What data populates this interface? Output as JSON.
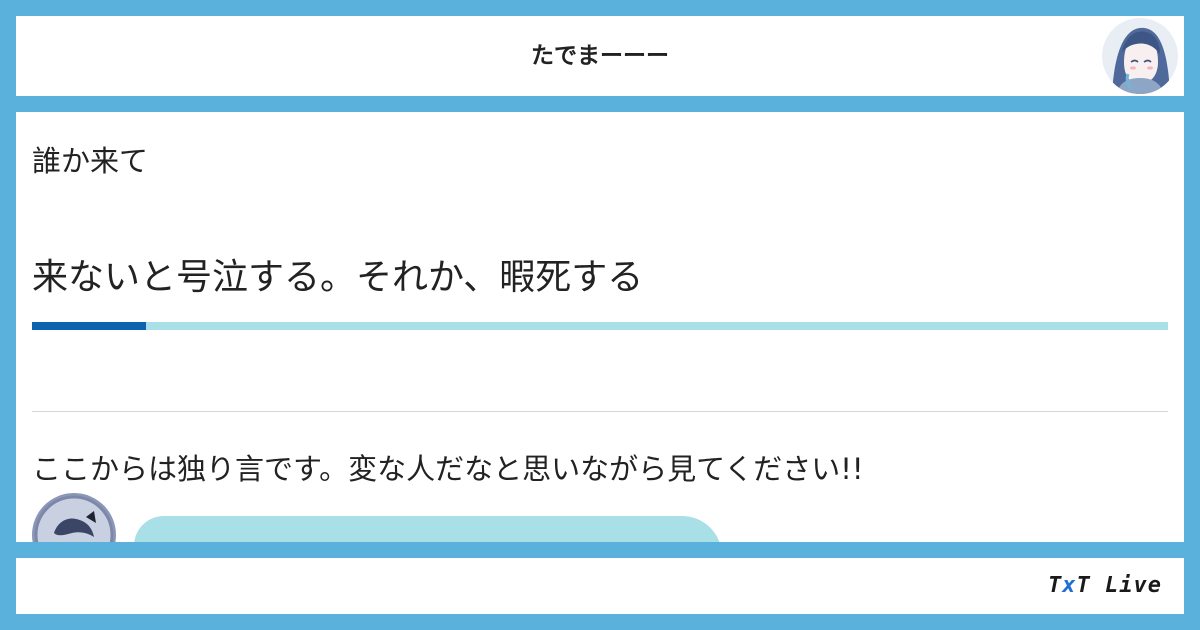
{
  "header": {
    "title": "たでまーーー"
  },
  "post": {
    "line1": "誰か来て",
    "line2": "来ないと号泣する。それか、暇死する",
    "progress": 0.1,
    "line3": "ここからは独り言です。変な人だなと思いながら見てください!!"
  },
  "footer": {
    "logo_text": "TxT Live"
  },
  "colors": {
    "frame": "#5ab1dc",
    "progress_fill": "#0d63ad",
    "progress_track": "#a9dfe6",
    "bubble": "#a9dfe6"
  },
  "icons": {
    "header_avatar": "user-avatar-icon",
    "post_avatar": "user-avatar-icon"
  }
}
